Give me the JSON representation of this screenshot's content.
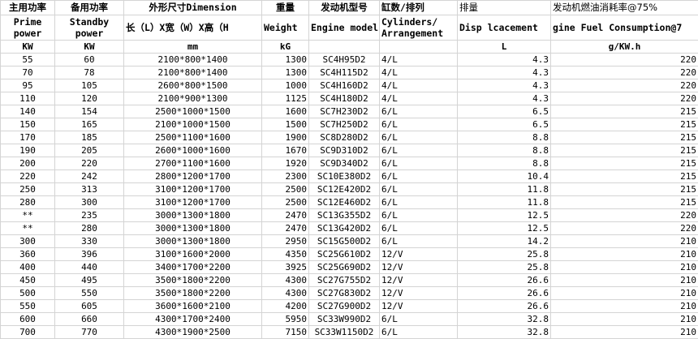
{
  "headers": {
    "prime_cn": "主用功率",
    "standby_cn": "备用功率",
    "dimension_cn": "外形尺寸Dimension",
    "weight_cn": "重量",
    "engine_cn": "发动机型号",
    "cyl_cn": "缸数/排列",
    "disp_cn": "排量",
    "fuel_cn": "发动机燃油消耗率@75%",
    "prime_en": "Prime power",
    "standby_en": "Standby power",
    "dimension_en": "长（L）X宽（W）X高（H",
    "weight_en": "Weight",
    "engine_en": "Engine model",
    "cyl_en": "Cylinders/ Arrangement",
    "disp_en": "Disp lcacement",
    "fuel_en": "gine Fuel Consumption@7",
    "prime_unit": "KW",
    "standby_unit": "KW",
    "dimension_unit": "mm",
    "weight_unit": "kG",
    "disp_unit": "L",
    "fuel_unit": "g/KW.h"
  },
  "rows": [
    [
      "55",
      "60",
      "2100*800*1400",
      "1300",
      "SC4H95D2",
      "4/L",
      "4.3",
      "220"
    ],
    [
      "70",
      "78",
      "2100*800*1400",
      "1300",
      "SC4H115D2",
      "4/L",
      "4.3",
      "220"
    ],
    [
      "95",
      "105",
      "2600*800*1500",
      "1000",
      "SC4H160D2",
      "4/L",
      "4.3",
      "220"
    ],
    [
      "110",
      "120",
      "2100*900*1300",
      "1125",
      "SC4H180D2",
      "4/L",
      "4.3",
      "220"
    ],
    [
      "140",
      "154",
      "2500*1000*1500",
      "1600",
      "SC7H230D2",
      "6/L",
      "6.5",
      "215"
    ],
    [
      "150",
      "165",
      "2100*1000*1500",
      "1500",
      "SC7H250D2",
      "6/L",
      "6.5",
      "215"
    ],
    [
      "170",
      "185",
      "2500*1100*1600",
      "1900",
      "SC8D280D2",
      "6/L",
      "8.8",
      "215"
    ],
    [
      "190",
      "205",
      "2600*1000*1600",
      "1670",
      "SC9D310D2",
      "6/L",
      "8.8",
      "215"
    ],
    [
      "200",
      "220",
      "2700*1100*1600",
      "1920",
      "SC9D340D2",
      "6/L",
      "8.8",
      "215"
    ],
    [
      "220",
      "242",
      "2800*1200*1700",
      "2300",
      "SC10E380D2",
      "6/L",
      "10.4",
      "215"
    ],
    [
      "250",
      "313",
      "3100*1200*1700",
      "2500",
      "SC12E420D2",
      "6/L",
      "11.8",
      "215"
    ],
    [
      "280",
      "300",
      "3100*1200*1700",
      "2500",
      "SC12E460D2",
      "6/L",
      "11.8",
      "215"
    ],
    [
      "**",
      "235",
      "3000*1300*1800",
      "2470",
      "SC13G355D2",
      "6/L",
      "12.5",
      "220"
    ],
    [
      "**",
      "280",
      "3000*1300*1800",
      "2470",
      "SC13G420D2",
      "6/L",
      "12.5",
      "220"
    ],
    [
      "300",
      "330",
      "3000*1300*1800",
      "2950",
      "SC15G500D2",
      "6/L",
      "14.2",
      "210"
    ],
    [
      "360",
      "396",
      "3100*1600*2000",
      "4350",
      "SC25G610D2",
      "12/V",
      "25.8",
      "210"
    ],
    [
      "400",
      "440",
      "3400*1700*2200",
      "3925",
      "SC25G690D2",
      "12/V",
      "25.8",
      "210"
    ],
    [
      "450",
      "495",
      "3500*1800*2200",
      "4300",
      "SC27G755D2",
      "12/V",
      "26.6",
      "210"
    ],
    [
      "500",
      "550",
      "3500*1800*2200",
      "4300",
      "SC27G830D2",
      "12/V",
      "26.6",
      "210"
    ],
    [
      "550",
      "605",
      "3600*1600*2100",
      "4200",
      "SC27G900D2",
      "12/V",
      "26.6",
      "210"
    ],
    [
      "600",
      "660",
      "4300*1700*2400",
      "5950",
      "SC33W990D2",
      "6/L",
      "32.8",
      "210"
    ],
    [
      "700",
      "770",
      "4300*1900*2500",
      "7150",
      "SC33W1150D2",
      "6/L",
      "32.8",
      "210"
    ]
  ]
}
